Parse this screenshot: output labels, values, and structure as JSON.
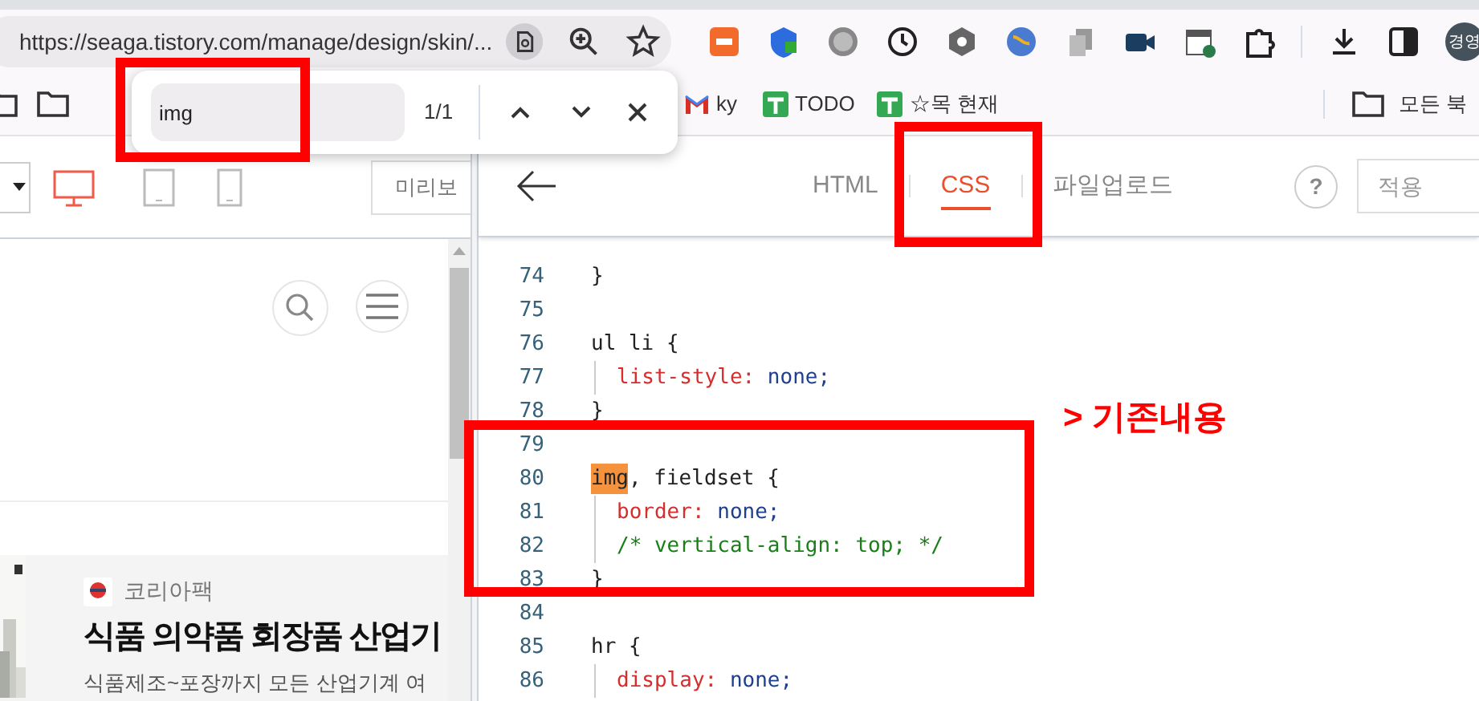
{
  "browser": {
    "url": "https://seaga.tistory.com/manage/design/skin/...",
    "bookmarks": [
      {
        "kind": "folder"
      },
      {
        "kind": "folder"
      },
      {
        "kind": "gmail",
        "label": "ky"
      },
      {
        "kind": "sheet",
        "label": "TODO"
      },
      {
        "kind": "sheet",
        "label": "☆목 현재"
      }
    ],
    "all_bookmarks": "모든 북",
    "profile": "경영"
  },
  "find_bar": {
    "value": "img",
    "count": "1/1"
  },
  "preview": {
    "preview_button": "미리보",
    "devices": [
      {
        "kind": "desktop",
        "selected": true
      },
      {
        "kind": "tablet",
        "selected": false
      },
      {
        "kind": "phone",
        "selected": false
      }
    ],
    "ad": {
      "source": "코리아팩",
      "title": "식품 의약품 회장품 산업기",
      "text": "식품제조~포장까지 모든 산업기계 여"
    }
  },
  "editor": {
    "tabs": [
      {
        "label": "HTML",
        "selected": false
      },
      {
        "label": "CSS",
        "selected": true
      },
      {
        "label": "파일업로드",
        "selected": false
      }
    ],
    "help": "?",
    "apply_button": "적용",
    "lines": [
      {
        "number": "74",
        "indent": false,
        "tokens": [
          {
            "text": "}",
            "kind": "plain"
          }
        ]
      },
      {
        "number": "75",
        "indent": false
      },
      {
        "number": "76",
        "indent": false,
        "tokens": [
          {
            "text": "ul li {",
            "kind": "plain"
          }
        ]
      },
      {
        "number": "77",
        "indent": true,
        "tokens": [
          {
            "text": "list-style:",
            "kind": "prop"
          },
          {
            "text": " none;",
            "kind": "value"
          }
        ]
      },
      {
        "number": "78",
        "indent": false,
        "tokens": [
          {
            "text": "}",
            "kind": "plain"
          }
        ]
      },
      {
        "number": "79",
        "indent": false
      },
      {
        "number": "80",
        "indent": false,
        "tokens": [
          {
            "text": "img",
            "kind": "match"
          },
          {
            "text": ", fieldset {",
            "kind": "plain"
          }
        ]
      },
      {
        "number": "81",
        "indent": true,
        "tokens": [
          {
            "text": "border:",
            "kind": "prop"
          },
          {
            "text": " none;",
            "kind": "value"
          }
        ]
      },
      {
        "number": "82",
        "indent": true,
        "tokens": [
          {
            "text": "/* vertical-align: top; */",
            "kind": "comment"
          }
        ]
      },
      {
        "number": "83",
        "indent": false,
        "tokens": [
          {
            "text": "}",
            "kind": "plain"
          }
        ]
      },
      {
        "number": "84",
        "indent": false
      },
      {
        "number": "85",
        "indent": false,
        "tokens": [
          {
            "text": "hr {",
            "kind": "plain"
          }
        ]
      },
      {
        "number": "86",
        "indent": true,
        "tokens": [
          {
            "text": "display:",
            "kind": "prop"
          },
          {
            "text": " none;",
            "kind": "value"
          }
        ]
      }
    ]
  },
  "annotation": {
    "text": "> 기존내용"
  }
}
